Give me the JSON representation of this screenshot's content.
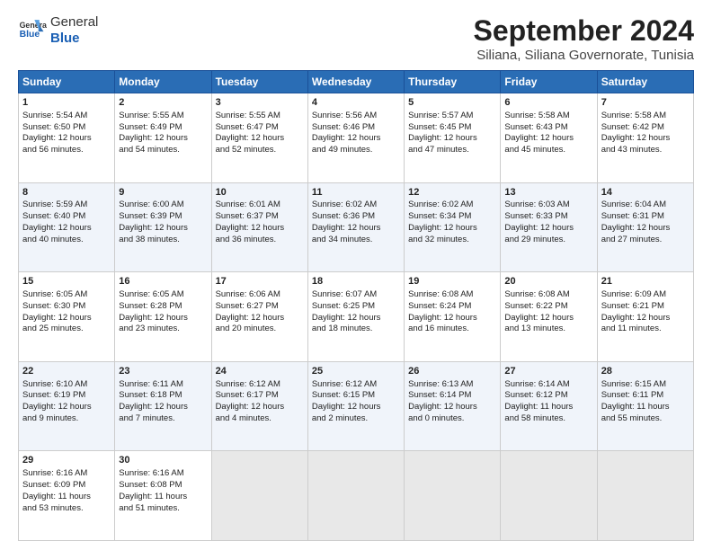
{
  "header": {
    "logo_general": "General",
    "logo_blue": "Blue",
    "title": "September 2024",
    "subtitle": "Siliana, Siliana Governorate, Tunisia"
  },
  "columns": [
    "Sunday",
    "Monday",
    "Tuesday",
    "Wednesday",
    "Thursday",
    "Friday",
    "Saturday"
  ],
  "weeks": [
    [
      {
        "day": "1",
        "lines": [
          "Sunrise: 5:54 AM",
          "Sunset: 6:50 PM",
          "Daylight: 12 hours",
          "and 56 minutes."
        ]
      },
      {
        "day": "2",
        "lines": [
          "Sunrise: 5:55 AM",
          "Sunset: 6:49 PM",
          "Daylight: 12 hours",
          "and 54 minutes."
        ]
      },
      {
        "day": "3",
        "lines": [
          "Sunrise: 5:55 AM",
          "Sunset: 6:47 PM",
          "Daylight: 12 hours",
          "and 52 minutes."
        ]
      },
      {
        "day": "4",
        "lines": [
          "Sunrise: 5:56 AM",
          "Sunset: 6:46 PM",
          "Daylight: 12 hours",
          "and 49 minutes."
        ]
      },
      {
        "day": "5",
        "lines": [
          "Sunrise: 5:57 AM",
          "Sunset: 6:45 PM",
          "Daylight: 12 hours",
          "and 47 minutes."
        ]
      },
      {
        "day": "6",
        "lines": [
          "Sunrise: 5:58 AM",
          "Sunset: 6:43 PM",
          "Daylight: 12 hours",
          "and 45 minutes."
        ]
      },
      {
        "day": "7",
        "lines": [
          "Sunrise: 5:58 AM",
          "Sunset: 6:42 PM",
          "Daylight: 12 hours",
          "and 43 minutes."
        ]
      }
    ],
    [
      {
        "day": "8",
        "lines": [
          "Sunrise: 5:59 AM",
          "Sunset: 6:40 PM",
          "Daylight: 12 hours",
          "and 40 minutes."
        ]
      },
      {
        "day": "9",
        "lines": [
          "Sunrise: 6:00 AM",
          "Sunset: 6:39 PM",
          "Daylight: 12 hours",
          "and 38 minutes."
        ]
      },
      {
        "day": "10",
        "lines": [
          "Sunrise: 6:01 AM",
          "Sunset: 6:37 PM",
          "Daylight: 12 hours",
          "and 36 minutes."
        ]
      },
      {
        "day": "11",
        "lines": [
          "Sunrise: 6:02 AM",
          "Sunset: 6:36 PM",
          "Daylight: 12 hours",
          "and 34 minutes."
        ]
      },
      {
        "day": "12",
        "lines": [
          "Sunrise: 6:02 AM",
          "Sunset: 6:34 PM",
          "Daylight: 12 hours",
          "and 32 minutes."
        ]
      },
      {
        "day": "13",
        "lines": [
          "Sunrise: 6:03 AM",
          "Sunset: 6:33 PM",
          "Daylight: 12 hours",
          "and 29 minutes."
        ]
      },
      {
        "day": "14",
        "lines": [
          "Sunrise: 6:04 AM",
          "Sunset: 6:31 PM",
          "Daylight: 12 hours",
          "and 27 minutes."
        ]
      }
    ],
    [
      {
        "day": "15",
        "lines": [
          "Sunrise: 6:05 AM",
          "Sunset: 6:30 PM",
          "Daylight: 12 hours",
          "and 25 minutes."
        ]
      },
      {
        "day": "16",
        "lines": [
          "Sunrise: 6:05 AM",
          "Sunset: 6:28 PM",
          "Daylight: 12 hours",
          "and 23 minutes."
        ]
      },
      {
        "day": "17",
        "lines": [
          "Sunrise: 6:06 AM",
          "Sunset: 6:27 PM",
          "Daylight: 12 hours",
          "and 20 minutes."
        ]
      },
      {
        "day": "18",
        "lines": [
          "Sunrise: 6:07 AM",
          "Sunset: 6:25 PM",
          "Daylight: 12 hours",
          "and 18 minutes."
        ]
      },
      {
        "day": "19",
        "lines": [
          "Sunrise: 6:08 AM",
          "Sunset: 6:24 PM",
          "Daylight: 12 hours",
          "and 16 minutes."
        ]
      },
      {
        "day": "20",
        "lines": [
          "Sunrise: 6:08 AM",
          "Sunset: 6:22 PM",
          "Daylight: 12 hours",
          "and 13 minutes."
        ]
      },
      {
        "day": "21",
        "lines": [
          "Sunrise: 6:09 AM",
          "Sunset: 6:21 PM",
          "Daylight: 12 hours",
          "and 11 minutes."
        ]
      }
    ],
    [
      {
        "day": "22",
        "lines": [
          "Sunrise: 6:10 AM",
          "Sunset: 6:19 PM",
          "Daylight: 12 hours",
          "and 9 minutes."
        ]
      },
      {
        "day": "23",
        "lines": [
          "Sunrise: 6:11 AM",
          "Sunset: 6:18 PM",
          "Daylight: 12 hours",
          "and 7 minutes."
        ]
      },
      {
        "day": "24",
        "lines": [
          "Sunrise: 6:12 AM",
          "Sunset: 6:17 PM",
          "Daylight: 12 hours",
          "and 4 minutes."
        ]
      },
      {
        "day": "25",
        "lines": [
          "Sunrise: 6:12 AM",
          "Sunset: 6:15 PM",
          "Daylight: 12 hours",
          "and 2 minutes."
        ]
      },
      {
        "day": "26",
        "lines": [
          "Sunrise: 6:13 AM",
          "Sunset: 6:14 PM",
          "Daylight: 12 hours",
          "and 0 minutes."
        ]
      },
      {
        "day": "27",
        "lines": [
          "Sunrise: 6:14 AM",
          "Sunset: 6:12 PM",
          "Daylight: 11 hours",
          "and 58 minutes."
        ]
      },
      {
        "day": "28",
        "lines": [
          "Sunrise: 6:15 AM",
          "Sunset: 6:11 PM",
          "Daylight: 11 hours",
          "and 55 minutes."
        ]
      }
    ],
    [
      {
        "day": "29",
        "lines": [
          "Sunrise: 6:16 AM",
          "Sunset: 6:09 PM",
          "Daylight: 11 hours",
          "and 53 minutes."
        ]
      },
      {
        "day": "30",
        "lines": [
          "Sunrise: 6:16 AM",
          "Sunset: 6:08 PM",
          "Daylight: 11 hours",
          "and 51 minutes."
        ]
      },
      {
        "day": "",
        "lines": []
      },
      {
        "day": "",
        "lines": []
      },
      {
        "day": "",
        "lines": []
      },
      {
        "day": "",
        "lines": []
      },
      {
        "day": "",
        "lines": []
      }
    ]
  ]
}
